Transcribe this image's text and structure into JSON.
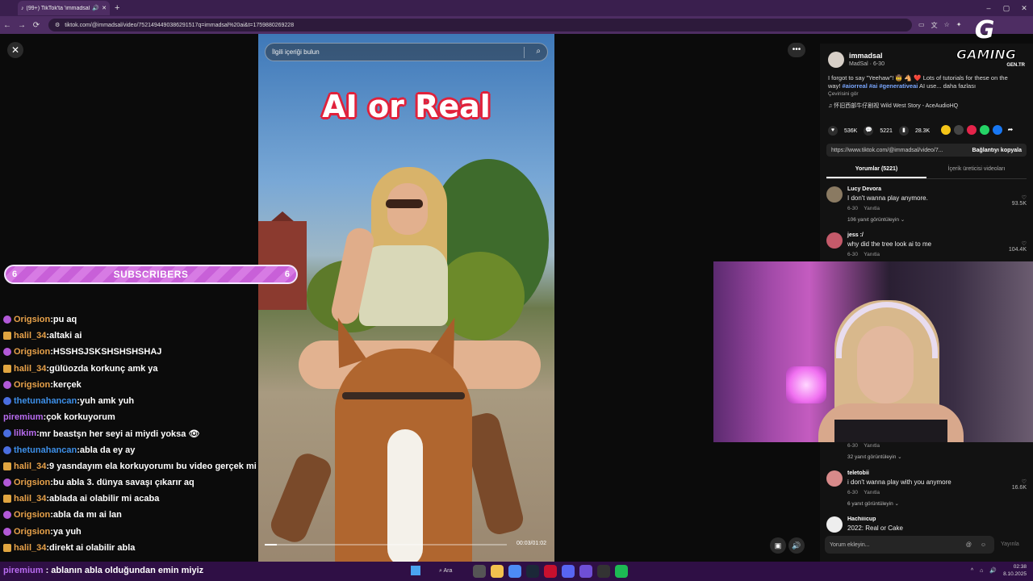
{
  "browser": {
    "tab_title": "(99+) TikTok'ta 'immadsal u…",
    "url": "tiktok.com/@immadsal/video/7521494490386291517q=immadsal%20ai&t=1759880269228",
    "new_tab": "+",
    "back": "←",
    "forward": "→",
    "reload": "⟳"
  },
  "stream": {
    "subscribers_label": "SUBSCRIBERS",
    "subscribers_left": "6",
    "subscribers_right": "6",
    "logo_word": "GAMING",
    "logo_sub": "GEN.TR"
  },
  "chat": [
    {
      "user": "Origsion",
      "msg": "pu aq",
      "color": "#e8a24a",
      "badge": "purple"
    },
    {
      "user": "halil_34",
      "msg": "altaki ai",
      "color": "#e8a24a",
      "badge": "gold"
    },
    {
      "user": "Origsion",
      "msg": "HSSHSJSKSHSHSHSHAJ",
      "color": "#e8a24a",
      "badge": "purple"
    },
    {
      "user": "halil_34",
      "msg": "gülüozda korkunç amk ya",
      "color": "#e8a24a",
      "badge": "gold"
    },
    {
      "user": "Origsion",
      "msg": "kerçek",
      "color": "#e8a24a",
      "badge": "purple"
    },
    {
      "user": "thetunahancan",
      "msg": "yuh amk yuh",
      "color": "#3d8fe8",
      "badge": "blue"
    },
    {
      "user": "piremium",
      "msg": "çok korkuyorum",
      "color": "#b86cf0",
      "badge": ""
    },
    {
      "user": "lilkim",
      "msg": "mr beastşn her seyi ai miydi yoksa 👁",
      "color": "#b86cf0",
      "badge": "blue"
    },
    {
      "user": "thetunahancan",
      "msg": "abla da ey ay",
      "color": "#3d8fe8",
      "badge": "blue"
    },
    {
      "user": "halil_34",
      "msg": "9 yasndayım ela korkuyorumı bu video gerçek mi",
      "color": "#e8a24a",
      "badge": "gold"
    },
    {
      "user": "Origsion",
      "msg": "bu abla 3. dünya savaşı çıkarır aq",
      "color": "#e8a24a",
      "badge": "purple"
    },
    {
      "user": "halil_34",
      "msg": "ablada ai olabilir mi acaba",
      "color": "#e8a24a",
      "badge": "gold"
    },
    {
      "user": "Origsion",
      "msg": "abla da mı ai lan",
      "color": "#e8a24a",
      "badge": "purple"
    },
    {
      "user": "Origsion",
      "msg": "ya yuh",
      "color": "#e8a24a",
      "badge": "purple"
    },
    {
      "user": "halil_34",
      "msg": "direkt ai olabilir abla",
      "color": "#e8a24a",
      "badge": "gold"
    }
  ],
  "chat_last": {
    "user": "piremium",
    "msg": "ablanın abla olduğundan emin miyiz",
    "color": "#b86cf0"
  },
  "video": {
    "search_placeholder": "İlgili içeriği bulun",
    "overlay_title": "AI or Real",
    "time": "00:03/01:02",
    "progress": 0.05
  },
  "panel": {
    "author": "immadsal",
    "author_sub": "MadSal · 6-30",
    "caption_text": "I forgot to say \"Yeehaw\"! 🤠 🐴 ❤️ Lots of tutorials for these on the way! ",
    "caption_tags": "#aiorreal #ai #generativeai",
    "caption_tail": " AI use...   daha fazlası",
    "see_translation": "Çevirisini gör",
    "music": "♫  怀旧西部牛仔剧视 Wild West Story - AceAudioHQ",
    "likes": "536K",
    "comments": "5221",
    "saves": "28.3K",
    "link": "https://www.tiktok.com/@immadsal/video/7...",
    "copy_label": "Bağlantıyı kopyala",
    "tab_comments": "Yorumlar (5221)",
    "tab_creator": "İçerik üreticisi videoları",
    "comments_list": [
      {
        "name": "Lucy Devora",
        "text": "I don't wanna play anymore.",
        "date": "6-30",
        "reply": "Yanıtla",
        "likes": "93.5K",
        "replies": "106 yanıt görüntüleyin ⌄"
      },
      {
        "name": "jess :/",
        "text": "why did the tree look ai to me",
        "date": "6-30",
        "reply": "Yanıtla",
        "likes": "104.4K",
        "replies": ""
      },
      {
        "name": "",
        "text": "",
        "date": "6-30",
        "reply": "Yanıtla",
        "likes": "",
        "replies": "32 yanıt görüntüleyin ⌄"
      },
      {
        "name": "teletobii",
        "text": "i don't wanna play with you anymore",
        "date": "6-30",
        "reply": "Yanıtla",
        "likes": "16.6K",
        "replies": "6 yanıt görüntüleyin ⌄"
      },
      {
        "name": "Hachiiicup",
        "text": "2022: Real or Cake",
        "date": "",
        "reply": "",
        "likes": "",
        "replies": ""
      }
    ],
    "comment_placeholder": "Yorum ekleyin...",
    "post": "Yayınla"
  },
  "taskbar": {
    "search": "Ara",
    "time": "02:38",
    "date": "8.10.2025"
  }
}
